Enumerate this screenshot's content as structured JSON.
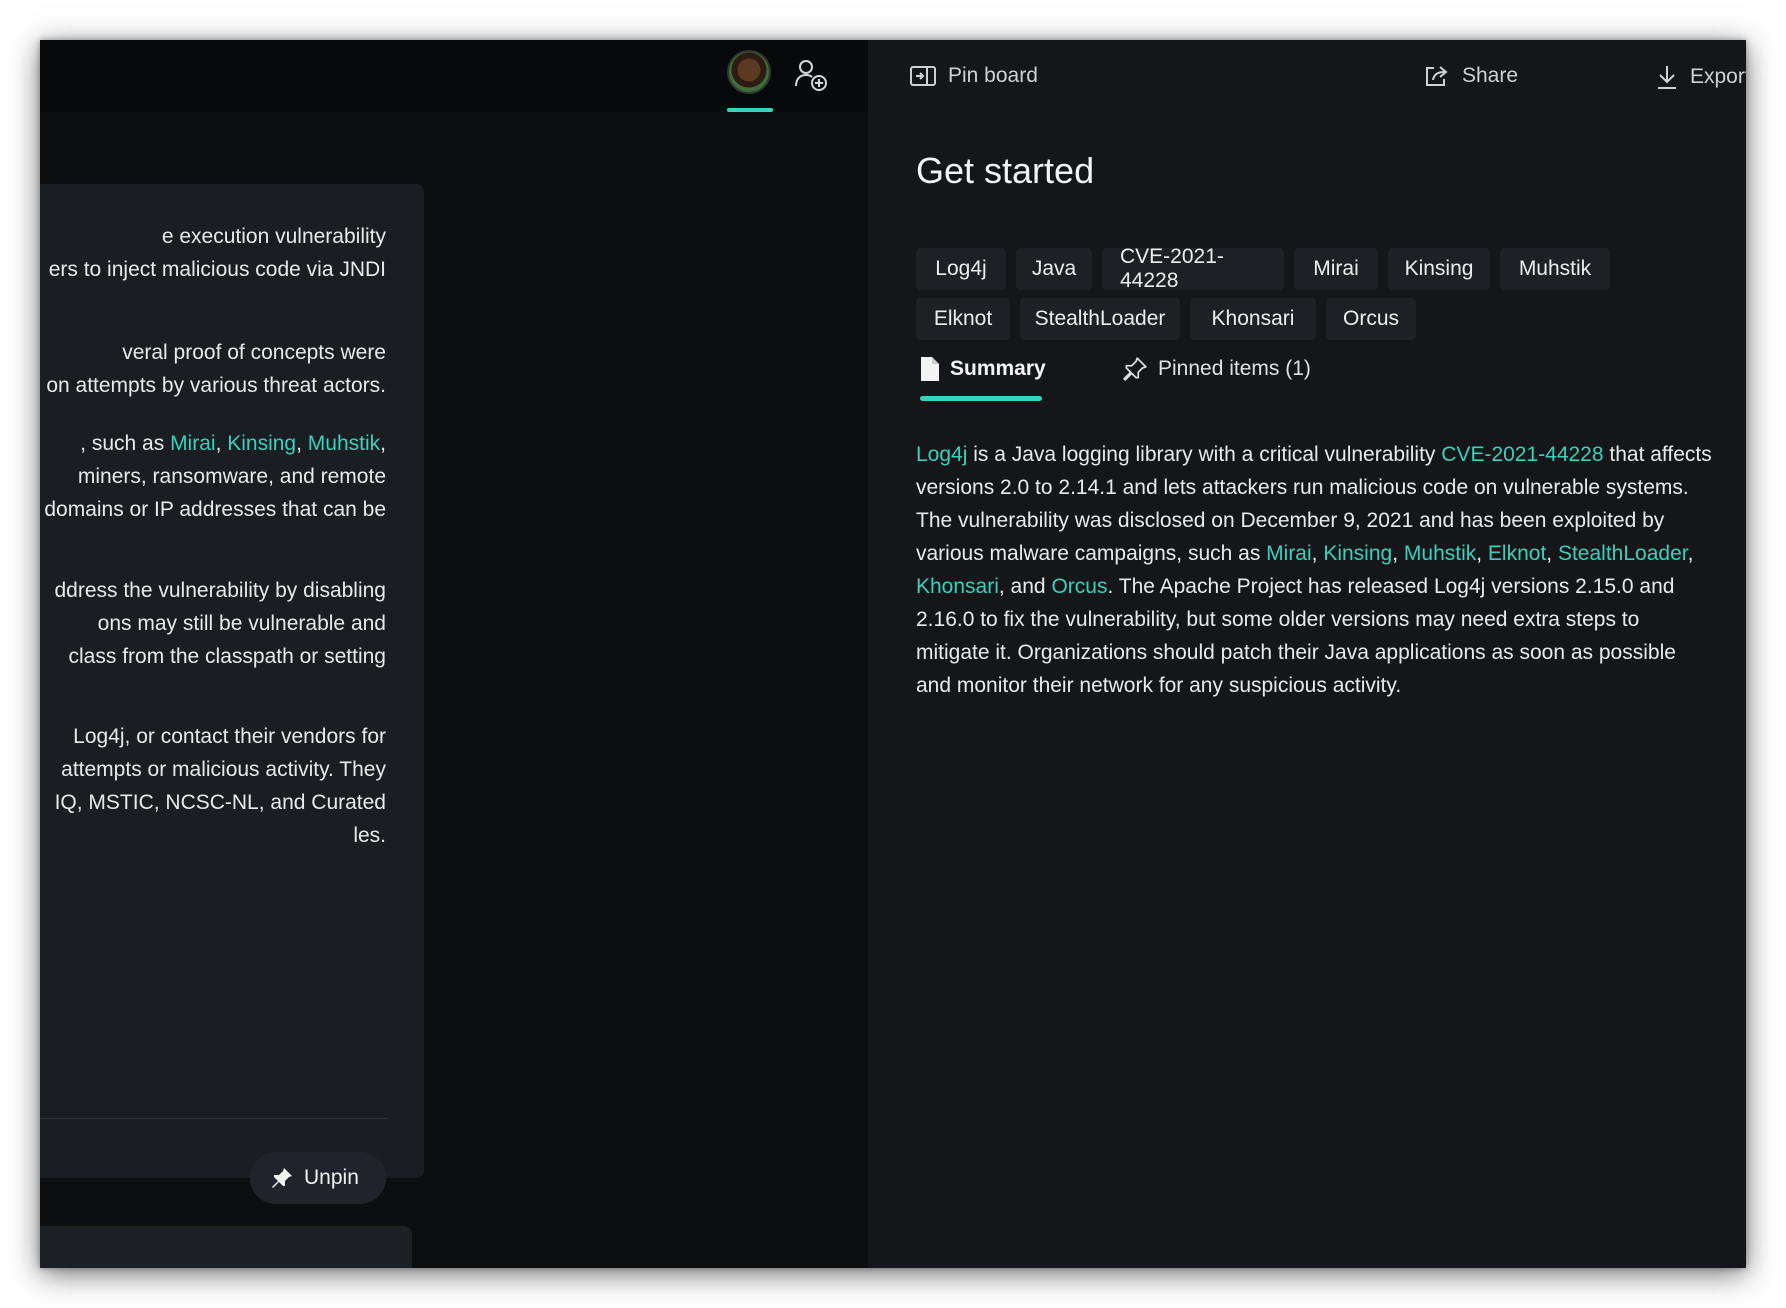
{
  "left": {
    "card_lines": [
      "e execution vulnerability",
      "ers to inject malicious code via JNDI",
      "",
      "",
      "veral proof of concepts were",
      "on attempts by various threat actors.",
      "",
      ", such as |Mirai|, |Kinsing|, |Muhstik|,",
      "miners, ransomware, and remote",
      "domains or IP addresses that can be",
      "",
      "",
      "ddress the vulnerability by disabling",
      "ons may still be vulnerable and",
      "class from the classpath or setting",
      "",
      "",
      "Log4j, or contact their vendors for",
      "attempts or malicious activity. They",
      "IQ, MSTIC, NCSC-NL, and Curated",
      "les."
    ],
    "unpin_label": "Unpin"
  },
  "toolbar": {
    "pin_board": "Pin board",
    "share": "Share",
    "export": "Export"
  },
  "title": "Get started",
  "chips": [
    "Log4j",
    "Java",
    "CVE-2021-44228",
    "Mirai",
    "Kinsing",
    "Muhstik",
    "Elknot",
    "StealthLoader",
    "Khonsari",
    "Orcus"
  ],
  "tabs": {
    "summary": "Summary",
    "pinned": "Pinned items (1)"
  },
  "summary": {
    "segments": [
      {
        "t": "Log4j",
        "link": true
      },
      {
        "t": " is a Java logging library with a critical vulnerability "
      },
      {
        "t": "CVE-2021-44228",
        "link": true
      },
      {
        "t": " that affects versions 2.0 to 2.14.1 and lets attackers run malicious code on vulnerable systems. The vulnerability was disclosed on December 9, 2021 and has been exploited by various malware campaigns, such as "
      },
      {
        "t": "Mirai",
        "link": true
      },
      {
        "t": ", "
      },
      {
        "t": "Kinsing",
        "link": true
      },
      {
        "t": ", "
      },
      {
        "t": "Muhstik",
        "link": true
      },
      {
        "t": ", "
      },
      {
        "t": "Elknot",
        "link": true
      },
      {
        "t": ", "
      },
      {
        "t": "StealthLoader",
        "link": true
      },
      {
        "t": ", "
      },
      {
        "t": "Khonsari",
        "link": true
      },
      {
        "t": ", and "
      },
      {
        "t": "Orcus",
        "link": true
      },
      {
        "t": ". The Apache Project has released Log4j versions 2.15.0 and 2.16.0 to fix the vulnerability, but some older versions may need extra steps to mitigate it. Organizations should patch their Java applications as soon as possible and monitor their network for any suspicious activity."
      }
    ]
  },
  "colors": {
    "accent": "#38d3bd",
    "link": "#3bd0bb",
    "background": "#141619"
  },
  "icons": [
    "avatar",
    "add-person-icon",
    "pin-board-icon",
    "share-icon",
    "export-icon",
    "document-icon",
    "pin-outline-icon",
    "pin-filled-icon"
  ]
}
